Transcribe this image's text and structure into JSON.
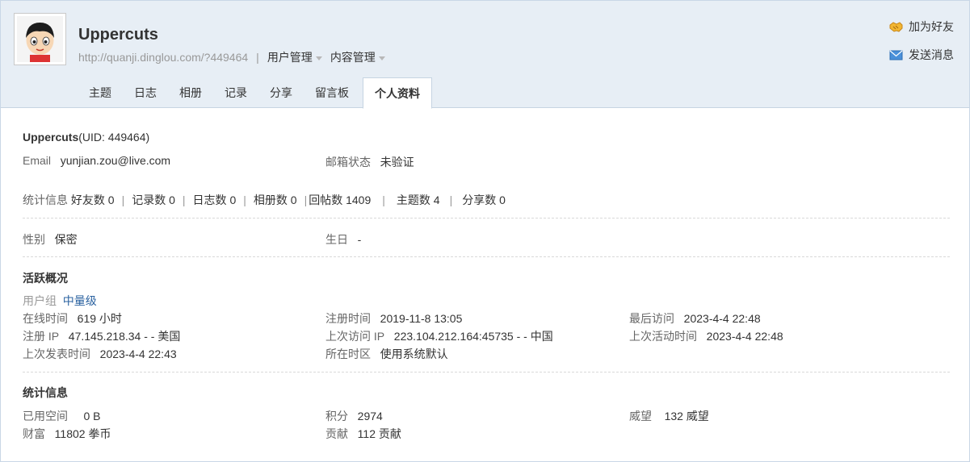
{
  "profile": {
    "name": "Uppercuts",
    "url": "http://quanji.dinglou.com/?449464",
    "menu_user": "用户管理",
    "menu_content": "内容管理",
    "sep": "|"
  },
  "actions": {
    "add_friend": "加为好友",
    "send_message": "发送消息"
  },
  "tabs": [
    "主题",
    "日志",
    "相册",
    "记录",
    "分享",
    "留言板",
    "个人资料"
  ],
  "active_tab": "个人资料",
  "info": {
    "name": "Uppercuts",
    "uid": "(UID: 449464)",
    "email_label": "Email",
    "email_value": "yunjian.zou@live.com",
    "mail_status_label": "邮箱状态",
    "mail_status_value": "未验证",
    "stats_label": "统计信息",
    "stats": [
      {
        "label": "好友数",
        "value": "0"
      },
      {
        "label": "记录数",
        "value": "0"
      },
      {
        "label": "日志数",
        "value": "0"
      },
      {
        "label": "相册数",
        "value": "0"
      },
      {
        "label": "回帖数",
        "value": "1409"
      },
      {
        "label": "主题数",
        "value": "4"
      },
      {
        "label": "分享数",
        "value": "0"
      }
    ],
    "gender_label": "性别",
    "gender_value": "保密",
    "birthday_label": "生日",
    "birthday_value": "-"
  },
  "activity": {
    "title": "活跃概况",
    "group_label": "用户组",
    "group_value": "中量级",
    "online_label": "在线时间",
    "online_value": "619 小时",
    "reg_time_label": "注册时间",
    "reg_time_value": "2019-11-8 13:05",
    "last_visit_label": "最后访问",
    "last_visit_value": "2023-4-4 22:48",
    "reg_ip_label": "注册 IP",
    "reg_ip_value": "47.145.218.34 - - 美国",
    "last_ip_label": "上次访问 IP",
    "last_ip_value": "223.104.212.164:45735 - - 中国",
    "last_active_label": "上次活动时间",
    "last_active_value": "2023-4-4 22:48",
    "last_post_label": "上次发表时间",
    "last_post_value": "2023-4-4 22:43",
    "timezone_label": "所在时区",
    "timezone_value": "使用系统默认"
  },
  "statistics": {
    "title": "统计信息",
    "space_label": "已用空间",
    "space_value": "0 B",
    "points_label": "积分",
    "points_value": "2974",
    "prestige_label": "威望",
    "prestige_value": "132 威望",
    "wealth_label": "财富",
    "wealth_value": "11802 拳币",
    "contrib_label": "贡献",
    "contrib_value": "112 贡献"
  },
  "icons": {
    "add_friend": "handshake-icon",
    "send_message": "envelope-icon",
    "avatar": "cartoon-boy-avatar"
  },
  "colors": {
    "header_bg": "#e7eef5",
    "link": "#2b62a0",
    "border": "#c6d4e2"
  }
}
